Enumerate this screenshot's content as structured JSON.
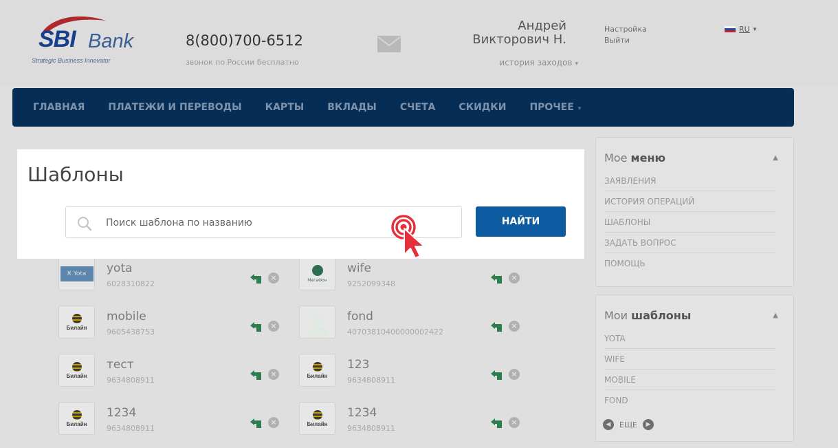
{
  "header": {
    "logo": {
      "brand": "SBI",
      "name": "Bank",
      "tagline": "Strategic Business Innovator"
    },
    "phone": "8(800)700-6512",
    "phone_note": "звонок по России бесплатно",
    "user": {
      "first": "Андрей",
      "rest": "Викторович Н."
    },
    "history_label": "история заходов",
    "settings_label": "Настройка",
    "logout_label": "Выйти",
    "language": "RU"
  },
  "nav": {
    "items": [
      "ГЛАВНАЯ",
      "ПЛАТЕЖИ И ПЕРЕВОДЫ",
      "КАРТЫ",
      "ВКЛАДЫ",
      "СЧЕТА",
      "СКИДКИ",
      "ПРОЧЕЕ"
    ]
  },
  "main": {
    "title": "Шаблоны",
    "search": {
      "placeholder": "Поиск шаблона по названию",
      "value": ""
    },
    "find_button": "НАЙТИ"
  },
  "templates": [
    {
      "name": "yota",
      "number": "6028310822",
      "operator": "Yota"
    },
    {
      "name": "wife",
      "number": "9252099348",
      "operator": "МегаФон"
    },
    {
      "name": "mobile",
      "number": "9605438753",
      "operator": "Билайн"
    },
    {
      "name": "fond",
      "number": "40703810400000002422",
      "operator": "fond"
    },
    {
      "name": "тест",
      "number": "9634808911",
      "operator": "Билайн"
    },
    {
      "name": "123",
      "number": "9634808911",
      "operator": "Билайн"
    },
    {
      "name": "1234",
      "number": "9634808911",
      "operator": "Билайн"
    },
    {
      "name": "1234",
      "number": "9634808911",
      "operator": "Билайн"
    }
  ],
  "sidebar": {
    "menu": {
      "title_light": "Мое",
      "title_bold": "меню",
      "items": [
        "ЗАЯВЛЕНИЯ",
        "ИСТОРИЯ ОПЕРАЦИЙ",
        "ШАБЛОНЫ",
        "ЗАДАТЬ ВОПРОС",
        "ПОМОЩЬ"
      ]
    },
    "templates": {
      "title_light": "Мои",
      "title_bold": "шаблоны",
      "items": [
        "YOTA",
        "WIFE",
        "MOBILE",
        "FOND"
      ],
      "more_label": "ЕЩЕ"
    }
  },
  "colors": {
    "nav_bg": "#062d56",
    "button_bg": "#0d5ba0",
    "cursor_red": "#e5303c",
    "accent_green": "#33734c"
  },
  "icons": [
    "envelope-icon",
    "search-icon",
    "repeat-icon",
    "close-icon",
    "chevron-up-icon",
    "chevron-left-icon",
    "chevron-right-icon",
    "pointer-cursor-icon"
  ]
}
